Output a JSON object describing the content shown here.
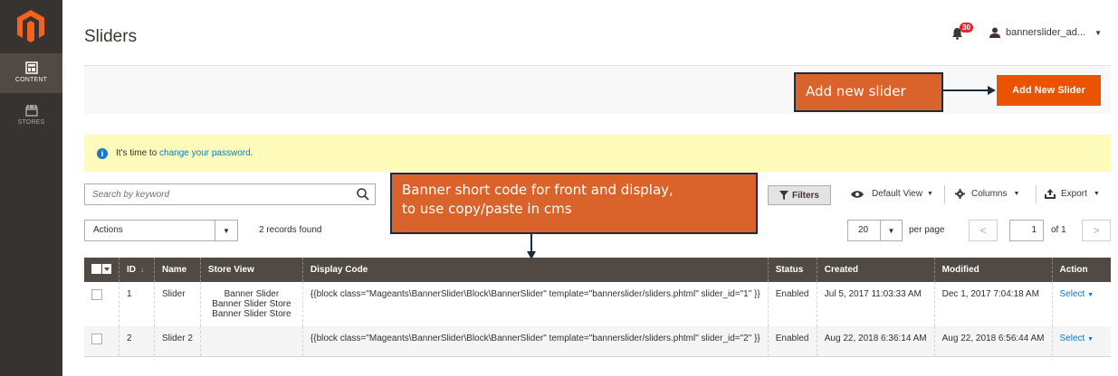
{
  "sidebar": {
    "items": [
      {
        "label": "CONTENT",
        "active": true
      },
      {
        "label": "STORES",
        "active": false
      }
    ]
  },
  "header": {
    "title": "Sliders",
    "notifications_count": "30",
    "user": "bannerslider_ad..."
  },
  "toolbar": {
    "add_button": "Add New Slider"
  },
  "annotations": {
    "add_slider": "Add new slider",
    "short_code_line1": "Banner short code for front and display,",
    "short_code_line2": "to use copy/paste in cms"
  },
  "notice": {
    "text": "It's time to",
    "link": "change your password",
    "suffix": "."
  },
  "search": {
    "placeholder": "Search by keyword"
  },
  "grid_controls": {
    "filters": "Filters",
    "default_view": "Default View",
    "columns": "Columns",
    "export": "Export",
    "actions": "Actions",
    "records_found": "2 records found",
    "per_page_value": "20",
    "per_page_label": "per page",
    "page_value": "1",
    "page_of": "of 1"
  },
  "table": {
    "columns": [
      "ID",
      "Name",
      "Store View",
      "Display Code",
      "Status",
      "Created",
      "Modified",
      "Action"
    ],
    "rows": [
      {
        "id": "1",
        "name": "Slider",
        "store_view": [
          "Banner Slider",
          "Banner Slider Store",
          "Banner Slider Store"
        ],
        "display_code": "{{block class=\"Mageants\\BannerSlider\\Block\\BannerSlider\" template=\"bannerslider/sliders.phtml\" slider_id=\"1\" }}",
        "status": "Enabled",
        "created": "Jul 5, 2017 11:03:33 AM",
        "modified": "Dec 1, 2017 7:04:18 AM",
        "action": "Select"
      },
      {
        "id": "2",
        "name": "Slider 2",
        "store_view": [],
        "display_code": "{{block class=\"Mageants\\BannerSlider\\Block\\BannerSlider\" template=\"bannerslider/sliders.phtml\" slider_id=\"2\" }}",
        "status": "Enabled",
        "created": "Aug 22, 2018 6:36:14 AM",
        "modified": "Aug 22, 2018 6:56:44 AM",
        "action": "Select"
      }
    ]
  },
  "colors": {
    "accent": "#eb5202",
    "sidebar": "#373330",
    "annotation": "#d9632a",
    "table_header": "#514943",
    "link": "#007bdb"
  }
}
